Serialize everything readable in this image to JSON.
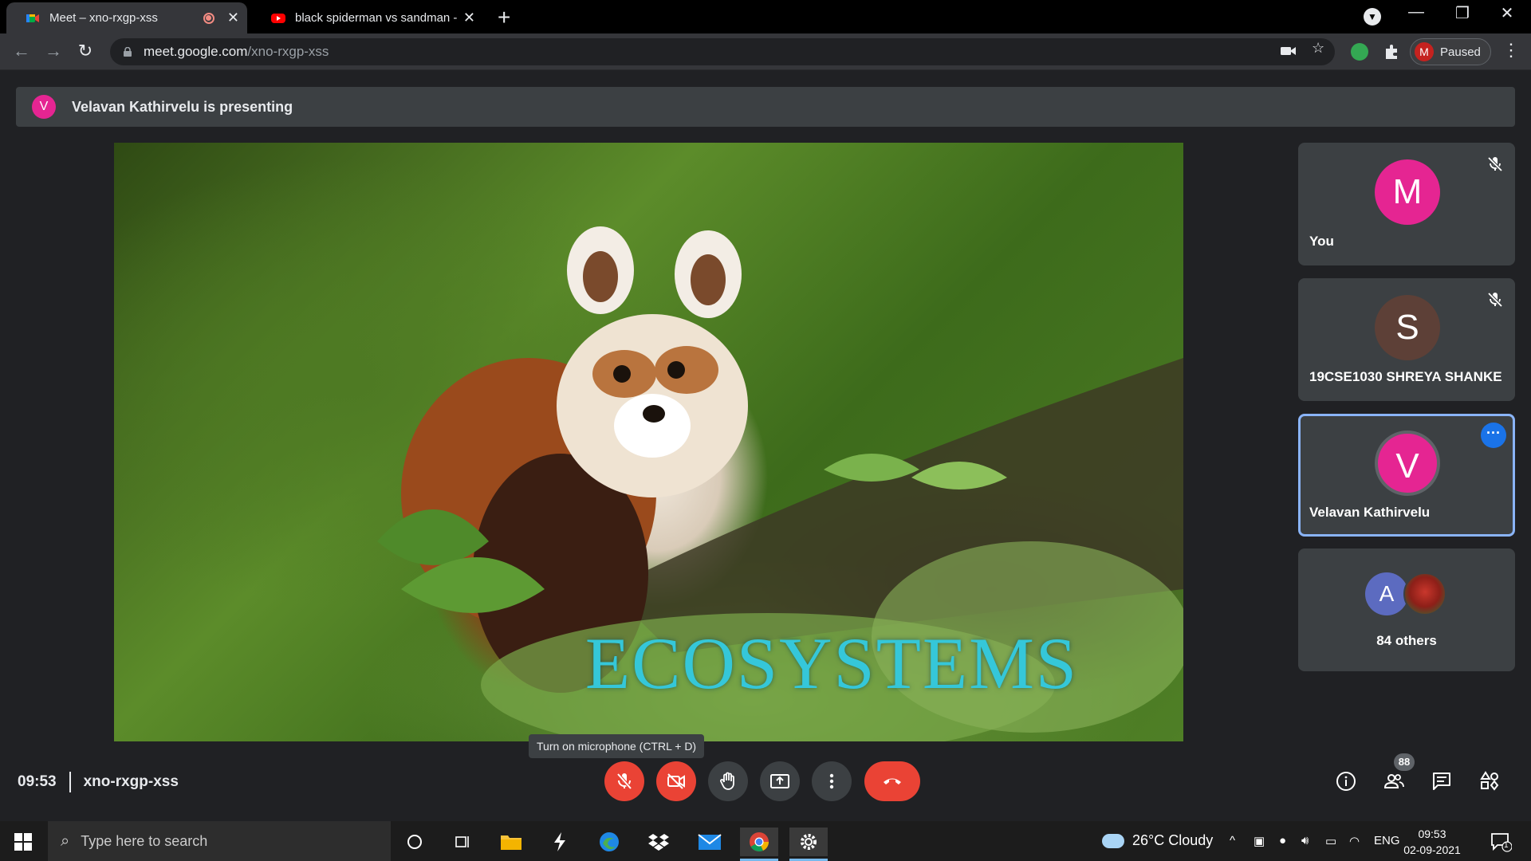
{
  "browser": {
    "tabs": [
      {
        "title": "Meet – xno-rxgp-xss",
        "active": true
      },
      {
        "title": "black spiderman vs sandman - Yo",
        "active": false
      }
    ],
    "url_host": "meet.google.com",
    "url_path": "/xno-rxgp-xss",
    "profile_initial": "M",
    "profile_status": "Paused"
  },
  "meeting": {
    "presenter_initial": "V",
    "presenting_text": "Velavan Kathirvelu is presenting",
    "slide_title": "ECOSYSTEMS",
    "time": "09:53",
    "code": "xno-rxgp-xss",
    "tooltip": "Turn on microphone (CTRL + D)",
    "participant_count": "88"
  },
  "participants": [
    {
      "initial": "M",
      "name": "You",
      "color": "#e52592",
      "muted": true
    },
    {
      "initial": "S",
      "name": "19CSE1030 SHREYA SHANKE",
      "color": "#5d4037",
      "muted": true
    },
    {
      "initial": "V",
      "name": "Velavan Kathirvelu",
      "color": "#e52592",
      "muted": false,
      "active": true
    }
  ],
  "others": {
    "initial": "A",
    "label": "84 others",
    "color": "#5c6bc0"
  },
  "taskbar": {
    "search_placeholder": "Type here to search",
    "weather": "26°C  Cloudy",
    "lang": "ENG",
    "time": "09:53",
    "date": "02-09-2021",
    "notification_count": "1"
  },
  "colors": {
    "accent": "#8ab4f8",
    "danger": "#ea4335",
    "slide_title": "#35c7d9"
  }
}
